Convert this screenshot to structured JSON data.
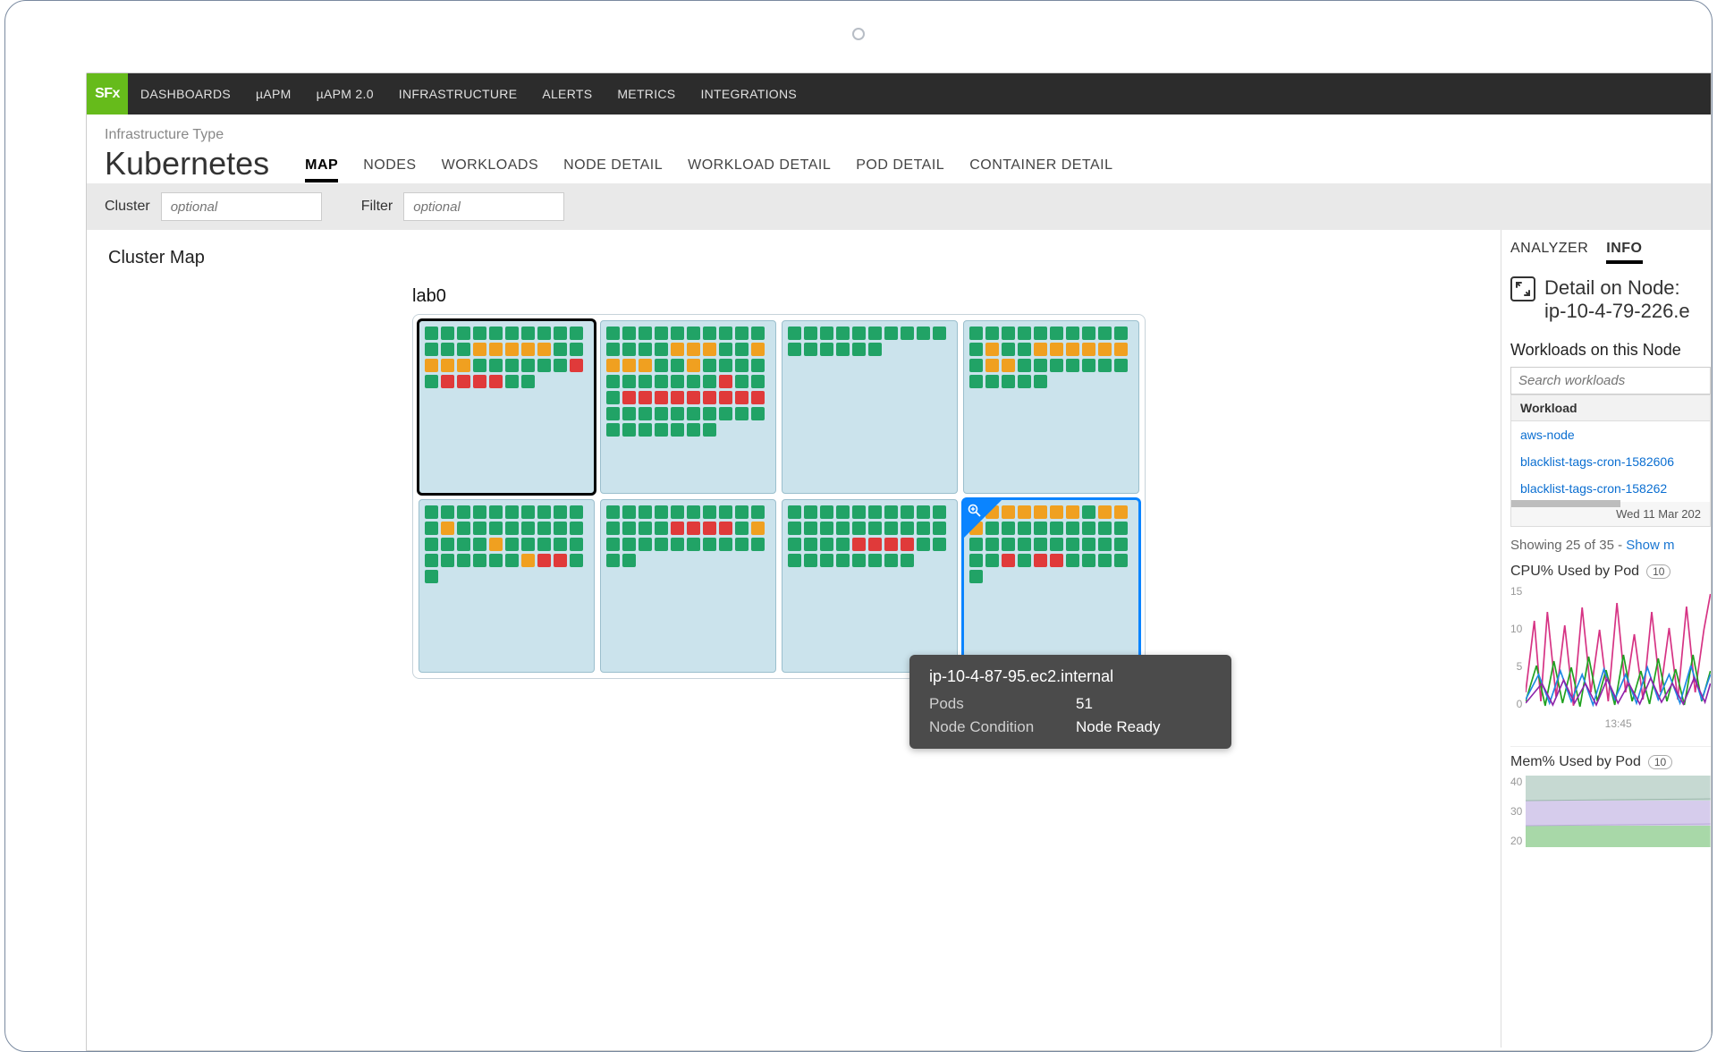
{
  "nav": {
    "logo": "SFx",
    "items": [
      "DASHBOARDS",
      "µAPM",
      "µAPM 2.0",
      "INFRASTRUCTURE",
      "ALERTS",
      "METRICS",
      "INTEGRATIONS"
    ]
  },
  "header": {
    "infra_type": "Infrastructure Type",
    "title": "Kubernetes",
    "subtabs": [
      "MAP",
      "NODES",
      "WORKLOADS",
      "NODE DETAIL",
      "WORKLOAD DETAIL",
      "POD DETAIL",
      "CONTAINER DETAIL"
    ],
    "active_subtab": "MAP"
  },
  "filters": {
    "cluster_label": "Cluster",
    "cluster_placeholder": "optional",
    "filter_label": "Filter",
    "filter_placeholder": "optional"
  },
  "cluster": {
    "heading": "Cluster Map",
    "name": "lab0"
  },
  "nodes": [
    {
      "select": "black",
      "rows": [
        "gggggggggg",
        "gggooooogg",
        "oooggggggr",
        "grrrrgg"
      ]
    },
    {
      "rows": [
        "gggggggggg",
        "ggggoooggo",
        "oooggogggg",
        "gggggggrgg",
        "grrrrrrrrr",
        "gggggggggg",
        "ggggggg"
      ]
    },
    {
      "rows": [
        "gggggggggg",
        "gggggg"
      ]
    },
    {
      "rows": [
        "gggggggggg",
        "goggoooooo",
        "googgggggg",
        "ggggg"
      ]
    },
    {
      "rows": [
        "gggggggggg",
        "gogggggggg",
        "ggggoggggg",
        "ggggggorrg",
        "g"
      ]
    },
    {
      "rows": [
        "gggggggggg",
        "ggggrrrrgo",
        "gggggggggg",
        "gg"
      ]
    },
    {
      "rows": [
        "gggggggggg",
        "gggggggggg",
        "ggggrrrrgg",
        "gggggggg"
      ]
    },
    {
      "select": "blue",
      "zoom": true,
      "rows": [
        "goooooogoo",
        "oggggggggg",
        "gggggggggg",
        "ggrgrrgggg",
        "g"
      ]
    }
  ],
  "tooltip": {
    "title": "ip-10-4-87-95.ec2.internal",
    "pods_label": "Pods",
    "pods_value": "51",
    "cond_label": "Node Condition",
    "cond_value": "Node Ready"
  },
  "side": {
    "tabs": [
      "ANALYZER",
      "INFO"
    ],
    "active_tab": "INFO",
    "detail_title": "Detail on Node:",
    "detail_subtitle": "ip-10-4-79-226.e",
    "workloads_title": "Workloads on this Node",
    "search_placeholder": "Search workloads",
    "table_header": "Workload",
    "rows": [
      "aws-node",
      "blacklist-tags-cron-1582606",
      "blacklist-tags-cron-158262"
    ],
    "footer_date": "Wed 11 Mar 202",
    "showing_prefix": "Showing 25 of 35 - ",
    "showing_link": "Show m",
    "cpu_title": "CPU% Used by Pod",
    "cpu_pill": "10",
    "cpu_yticks": [
      "15",
      "10",
      "5",
      "0"
    ],
    "cpu_xtick": "13:45",
    "mem_title": "Mem% Used by Pod",
    "mem_pill": "10",
    "mem_yticks": [
      "40",
      "30",
      "20"
    ]
  },
  "chart_data": [
    {
      "type": "line",
      "title": "CPU% Used by Pod",
      "ylabel": "%",
      "ylim": [
        0,
        15
      ],
      "x_tick_label": "13:45",
      "note": "multiple pod series, spiky 0–15%"
    },
    {
      "type": "area",
      "title": "Mem% Used by Pod",
      "ylabel": "%",
      "ylim": [
        20,
        40
      ],
      "note": "stacked area, bands around 20/30/40"
    }
  ]
}
